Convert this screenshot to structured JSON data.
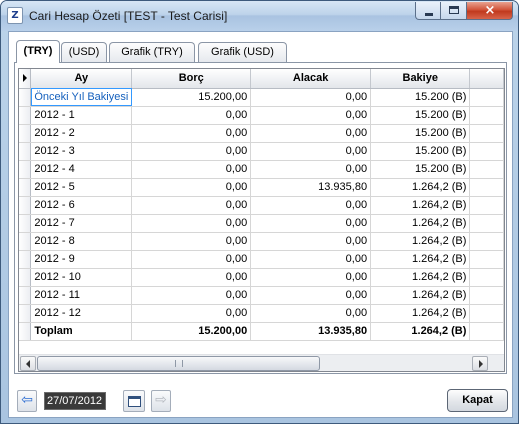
{
  "window": {
    "title": "Cari Hesap Özeti [TEST - Test Carisi]",
    "app_icon_letter": "Z",
    "close_glyph": "×"
  },
  "tabs": [
    {
      "label": "(TRY)",
      "active": true
    },
    {
      "label": "(USD)",
      "active": false
    },
    {
      "label": "Grafik (TRY)",
      "active": false
    },
    {
      "label": "Grafik (USD)",
      "active": false
    }
  ],
  "grid": {
    "columns": [
      "Ay",
      "Borç",
      "Alacak",
      "Bakiye"
    ],
    "rows": [
      [
        "Önceki Yıl Bakiyesi",
        "15.200,00",
        "0,00",
        "15.200 (B)"
      ],
      [
        "2012 - 1",
        "0,00",
        "0,00",
        "15.200 (B)"
      ],
      [
        "2012 - 2",
        "0,00",
        "0,00",
        "15.200 (B)"
      ],
      [
        "2012 - 3",
        "0,00",
        "0,00",
        "15.200 (B)"
      ],
      [
        "2012 - 4",
        "0,00",
        "0,00",
        "15.200 (B)"
      ],
      [
        "2012 - 5",
        "0,00",
        "13.935,80",
        "1.264,2 (B)"
      ],
      [
        "2012 - 6",
        "0,00",
        "0,00",
        "1.264,2 (B)"
      ],
      [
        "2012 - 7",
        "0,00",
        "0,00",
        "1.264,2 (B)"
      ],
      [
        "2012 - 8",
        "0,00",
        "0,00",
        "1.264,2 (B)"
      ],
      [
        "2012 - 9",
        "0,00",
        "0,00",
        "1.264,2 (B)"
      ],
      [
        "2012 - 10",
        "0,00",
        "0,00",
        "1.264,2 (B)"
      ],
      [
        "2012 - 11",
        "0,00",
        "0,00",
        "1.264,2 (B)"
      ],
      [
        "2012 - 12",
        "0,00",
        "0,00",
        "1.264,2 (B)"
      ]
    ],
    "total": [
      "Toplam",
      "15.200,00",
      "13.935,80",
      "1.264,2 (B)"
    ]
  },
  "footer": {
    "date_value": "27/07/2012",
    "prev_glyph": "⇦",
    "next_glyph": "⇨",
    "close_button_label": "Kapat"
  }
}
